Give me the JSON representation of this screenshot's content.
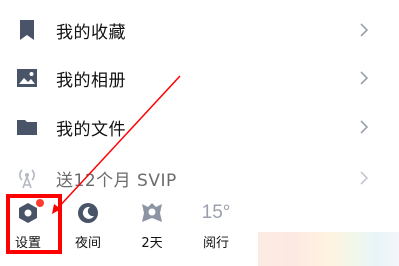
{
  "menu": {
    "items": [
      {
        "label": "我的收藏",
        "icon": "bookmark-icon"
      },
      {
        "label": "我的相册",
        "icon": "image-icon"
      },
      {
        "label": "我的文件",
        "icon": "folder-icon"
      },
      {
        "label": "送12个月 SVIP",
        "icon": "broadcast-icon"
      }
    ]
  },
  "bottom_bar": {
    "settings_label": "设置",
    "night_label": "夜间",
    "days_label": "2天",
    "reading_label": "阅行",
    "temperature": "15°"
  },
  "colors": {
    "icon": "#4a5468",
    "annotation": "#ff0000",
    "badge": "#ff3b30"
  }
}
